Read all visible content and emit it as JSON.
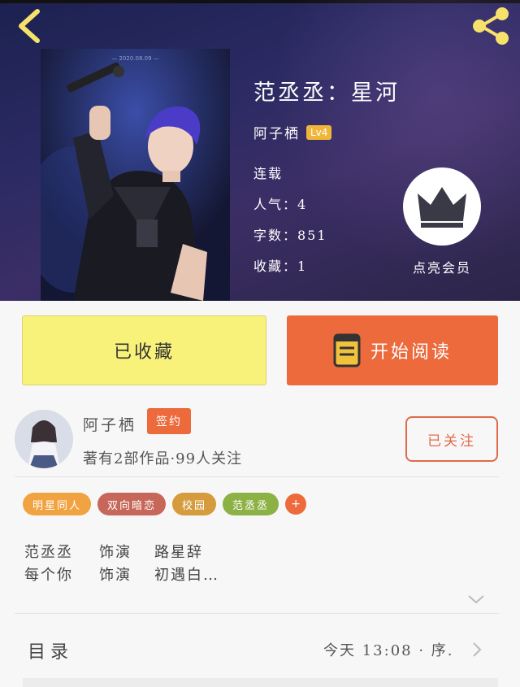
{
  "header": {
    "back_icon": "chevron-left-icon",
    "share_icon": "share-icon"
  },
  "book": {
    "title": "范丞丞：星河",
    "author": "阿子栖",
    "author_level": "Lv4",
    "status": "连载",
    "popularity": "人气：4",
    "word_count": "字数：851",
    "favorites": "收藏：1",
    "cover_caption": "— 2020.08.09 —"
  },
  "vip": {
    "label": "点亮会员",
    "icon": "crown-icon"
  },
  "actions": {
    "collected_label": "已收藏",
    "read_label": "开始阅读"
  },
  "author_card": {
    "name": "阿子栖",
    "signed_badge": "签约",
    "stats": "著有2部作品·99人关注",
    "follow_label": "已关注"
  },
  "tags": [
    {
      "label": "明星同人",
      "color": "#f0a340"
    },
    {
      "label": "双向暗恋",
      "color": "#c6675a"
    },
    {
      "label": "校园",
      "color": "#d59b3c"
    },
    {
      "label": "范丞丞",
      "color": "#8cb145"
    }
  ],
  "tag_add": "+",
  "cast": [
    [
      "范丞丞",
      "饰演",
      "路星辞"
    ],
    [
      "每个你",
      "饰演",
      "初遇白…"
    ]
  ],
  "toc": {
    "label": "目录",
    "latest": "今天 13:08 · 序."
  },
  "colors": {
    "accent": "#ec6a3c",
    "collected_bg": "#f9f27a",
    "badge": "#f0b63a",
    "hero_bg": "#2b2a63"
  }
}
